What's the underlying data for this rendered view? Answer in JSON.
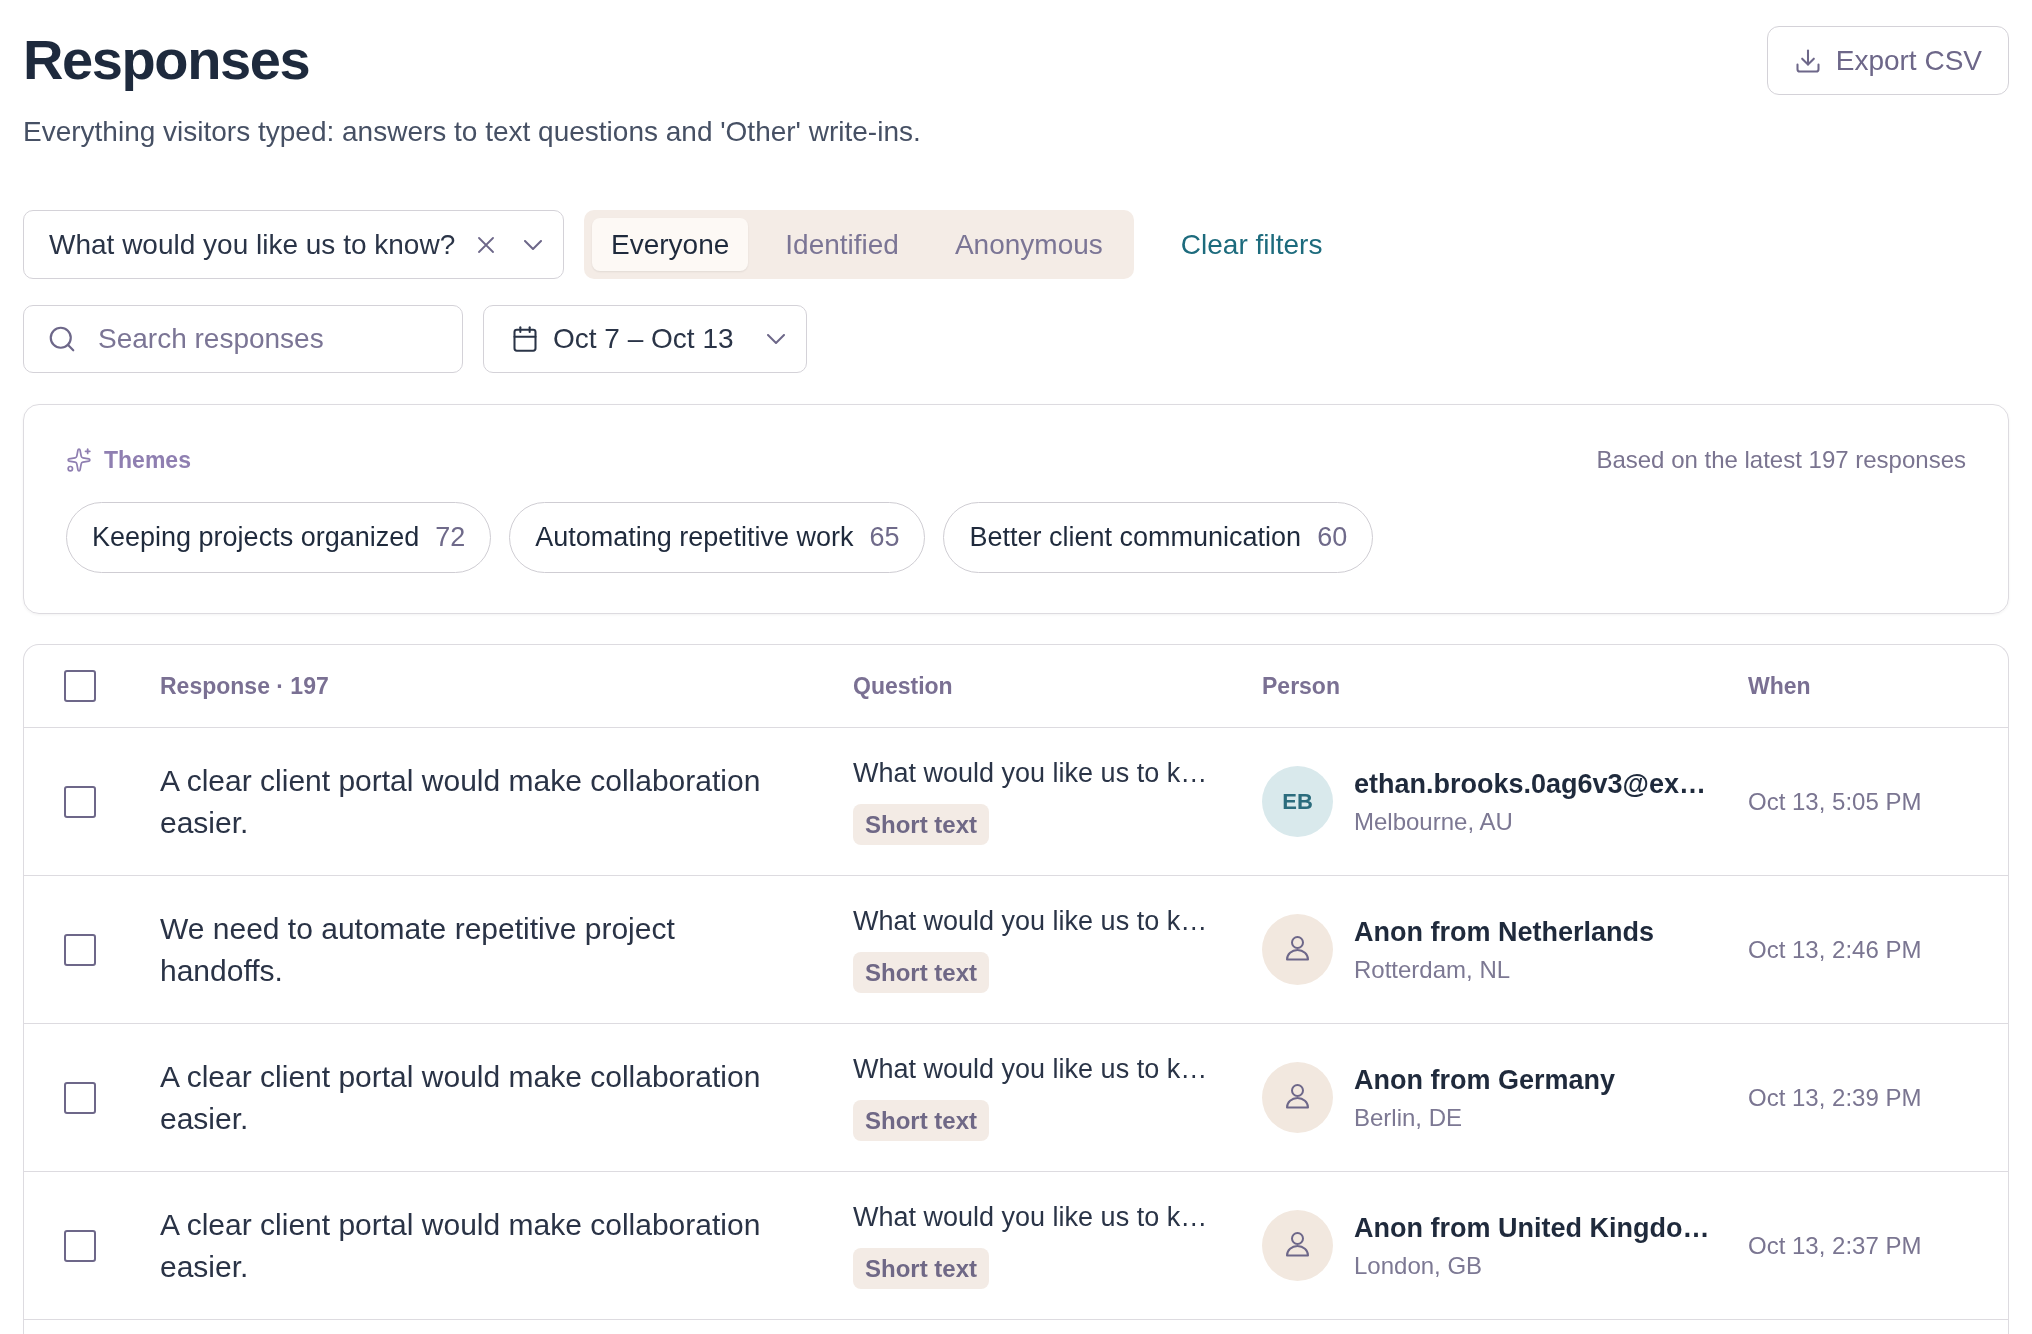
{
  "header": {
    "title": "Responses",
    "subtitle": "Everything visitors typed: answers to text questions and 'Other' write-ins.",
    "export_button": "Export CSV"
  },
  "filters": {
    "question_select": {
      "value": "What would you like us to know?"
    },
    "audience_tabs": [
      {
        "label": "Everyone",
        "selected": true
      },
      {
        "label": "Identified",
        "selected": false
      },
      {
        "label": "Anonymous",
        "selected": false
      }
    ],
    "clear_filters": "Clear filters",
    "search": {
      "placeholder": "Search responses"
    },
    "date_range": {
      "value": "Oct 7 – Oct 13"
    }
  },
  "themes": {
    "title": "Themes",
    "note": "Based on the latest 197 responses",
    "chips": [
      {
        "label": "Keeping projects organized",
        "count": "72"
      },
      {
        "label": "Automating repetitive work",
        "count": "65"
      },
      {
        "label": "Better client communication",
        "count": "60"
      }
    ]
  },
  "table": {
    "select_all": {
      "checked": false
    },
    "columns": [
      "Response · 197",
      "Question",
      "Person",
      "When"
    ],
    "rows": [
      {
        "checked": false,
        "response": "A clear client portal would make collaboration easier.",
        "question": "What would you like us to k…",
        "question_type": "Short text",
        "person": {
          "kind": "initials",
          "initials": "EB",
          "name": "ethan.brooks.0ag6v3@ex…",
          "location": "Melbourne, AU"
        },
        "when": "Oct 13, 5:05 PM"
      },
      {
        "checked": false,
        "response": "We need to automate repetitive project handoffs.",
        "question": "What would you like us to k…",
        "question_type": "Short text",
        "person": {
          "kind": "anonymous",
          "name": "Anon from Netherlands",
          "location": "Rotterdam, NL"
        },
        "when": "Oct 13, 2:46 PM"
      },
      {
        "checked": false,
        "response": "A clear client portal would make collaboration easier.",
        "question": "What would you like us to k…",
        "question_type": "Short text",
        "person": {
          "kind": "anonymous",
          "name": "Anon from Germany",
          "location": "Berlin, DE"
        },
        "when": "Oct 13, 2:39 PM"
      },
      {
        "checked": false,
        "response": "A clear client portal would make collaboration easier.",
        "question": "What would you like us to k…",
        "question_type": "Short text",
        "person": {
          "kind": "anonymous",
          "name": "Anon from United Kingdo…",
          "location": "London, GB"
        },
        "when": "Oct 13, 2:37 PM"
      }
    ]
  }
}
